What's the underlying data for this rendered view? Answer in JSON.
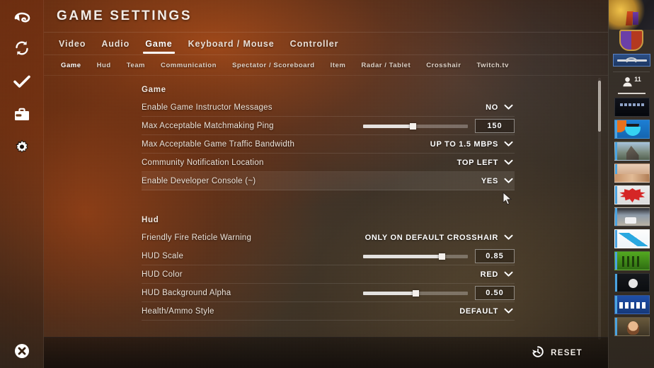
{
  "window": {
    "title": "GAME SETTINGS"
  },
  "rail": {
    "items": [
      {
        "name": "back-arrow-icon",
        "label": "Back"
      },
      {
        "name": "refresh-icon",
        "label": "Refresh"
      },
      {
        "name": "check-icon",
        "label": "Accept"
      },
      {
        "name": "briefcase-icon",
        "label": "Inventory"
      },
      {
        "name": "gear-icon",
        "label": "Settings"
      }
    ],
    "close": {
      "name": "close-icon",
      "label": "Close"
    }
  },
  "tabs": [
    {
      "label": "Video",
      "active": false
    },
    {
      "label": "Audio",
      "active": false
    },
    {
      "label": "Game",
      "active": true
    },
    {
      "label": "Keyboard / Mouse",
      "active": false
    },
    {
      "label": "Controller",
      "active": false
    }
  ],
  "subtabs": [
    {
      "label": "Game",
      "active": true
    },
    {
      "label": "Hud",
      "active": false
    },
    {
      "label": "Team",
      "active": false
    },
    {
      "label": "Communication",
      "active": false
    },
    {
      "label": "Spectator / Scoreboard",
      "active": false
    },
    {
      "label": "Item",
      "active": false
    },
    {
      "label": "Radar / Tablet",
      "active": false
    },
    {
      "label": "Crosshair",
      "active": false
    },
    {
      "label": "Twitch.tv",
      "active": false
    }
  ],
  "sections": [
    {
      "heading": "Game",
      "rows": [
        {
          "label": "Enable Game Instructor Messages",
          "control": "dropdown",
          "value": "NO",
          "hovered": false
        },
        {
          "label": "Max Acceptable Matchmaking Ping",
          "control": "slider",
          "value": "150",
          "percent": 47,
          "hovered": false
        },
        {
          "label": "Max Acceptable Game Traffic Bandwidth",
          "control": "dropdown",
          "value": "UP TO 1.5 MBPS",
          "hovered": false
        },
        {
          "label": "Community Notification Location",
          "control": "dropdown",
          "value": "TOP LEFT",
          "hovered": false
        },
        {
          "label": "Enable Developer Console (~)",
          "control": "dropdown",
          "value": "YES",
          "hovered": true
        }
      ]
    },
    {
      "heading": "Hud",
      "rows": [
        {
          "label": "Friendly Fire Reticle Warning",
          "control": "dropdown",
          "value": "ONLY ON DEFAULT CROSSHAIR",
          "hovered": false
        },
        {
          "label": "HUD Scale",
          "control": "slider",
          "value": "0.85",
          "percent": 75,
          "hovered": false
        },
        {
          "label": "HUD Color",
          "control": "dropdown",
          "value": "RED",
          "hovered": false
        },
        {
          "label": "HUD Background Alpha",
          "control": "slider",
          "value": "0.50",
          "percent": 50,
          "hovered": false
        },
        {
          "label": "Health/Ammo Style",
          "control": "dropdown",
          "value": "DEFAULT",
          "hovered": false
        }
      ]
    }
  ],
  "footer": {
    "reset_label": "RESET",
    "reset_icon": "history-revert-icon"
  },
  "rightbar": {
    "friend_count": "11",
    "friend_icon": "person-icon",
    "showcase": [
      {
        "name": "medal-badge"
      },
      {
        "name": "shield-emblem"
      },
      {
        "name": "weapon-skin-banner"
      }
    ],
    "thumbnail_count": 11
  },
  "colors": {
    "accent_orange": "#b04c16",
    "panel_brown": "#43372a",
    "text_primary": "#f3ece6",
    "text_value": "#ffffff",
    "rightbar_bg": "#3a322a"
  }
}
